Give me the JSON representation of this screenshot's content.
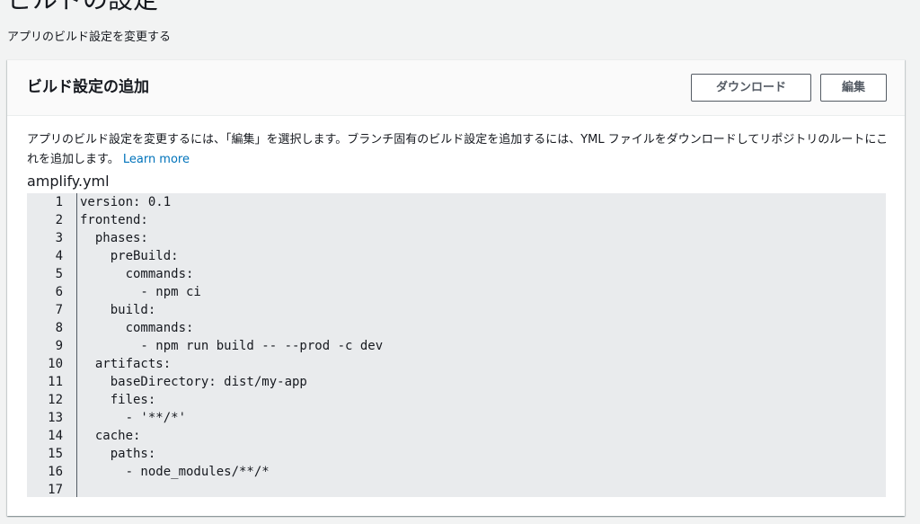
{
  "page": {
    "title": "ビルドの設定",
    "subtitle": "アプリのビルド設定を変更する"
  },
  "panel": {
    "title": "ビルド設定の追加",
    "download_label": "ダウンロード",
    "edit_label": "編集",
    "description": "アプリのビルド設定を変更するには、「編集」を選択します。ブランチ固有のビルド設定を追加するには、YML ファイルをダウンロードしてリポジトリのルートにこれを追加します。",
    "learn_more": "Learn more",
    "filename": "amplify.yml"
  },
  "code": {
    "lines": [
      "version: 0.1",
      "frontend:",
      "  phases:",
      "    preBuild:",
      "      commands:",
      "        - npm ci",
      "    build:",
      "      commands:",
      "        - npm run build -- --prod -c dev",
      "  artifacts:",
      "    baseDirectory: dist/my-app",
      "    files:",
      "      - '**/*'",
      "  cache:",
      "    paths:",
      "      - node_modules/**/*",
      ""
    ]
  }
}
